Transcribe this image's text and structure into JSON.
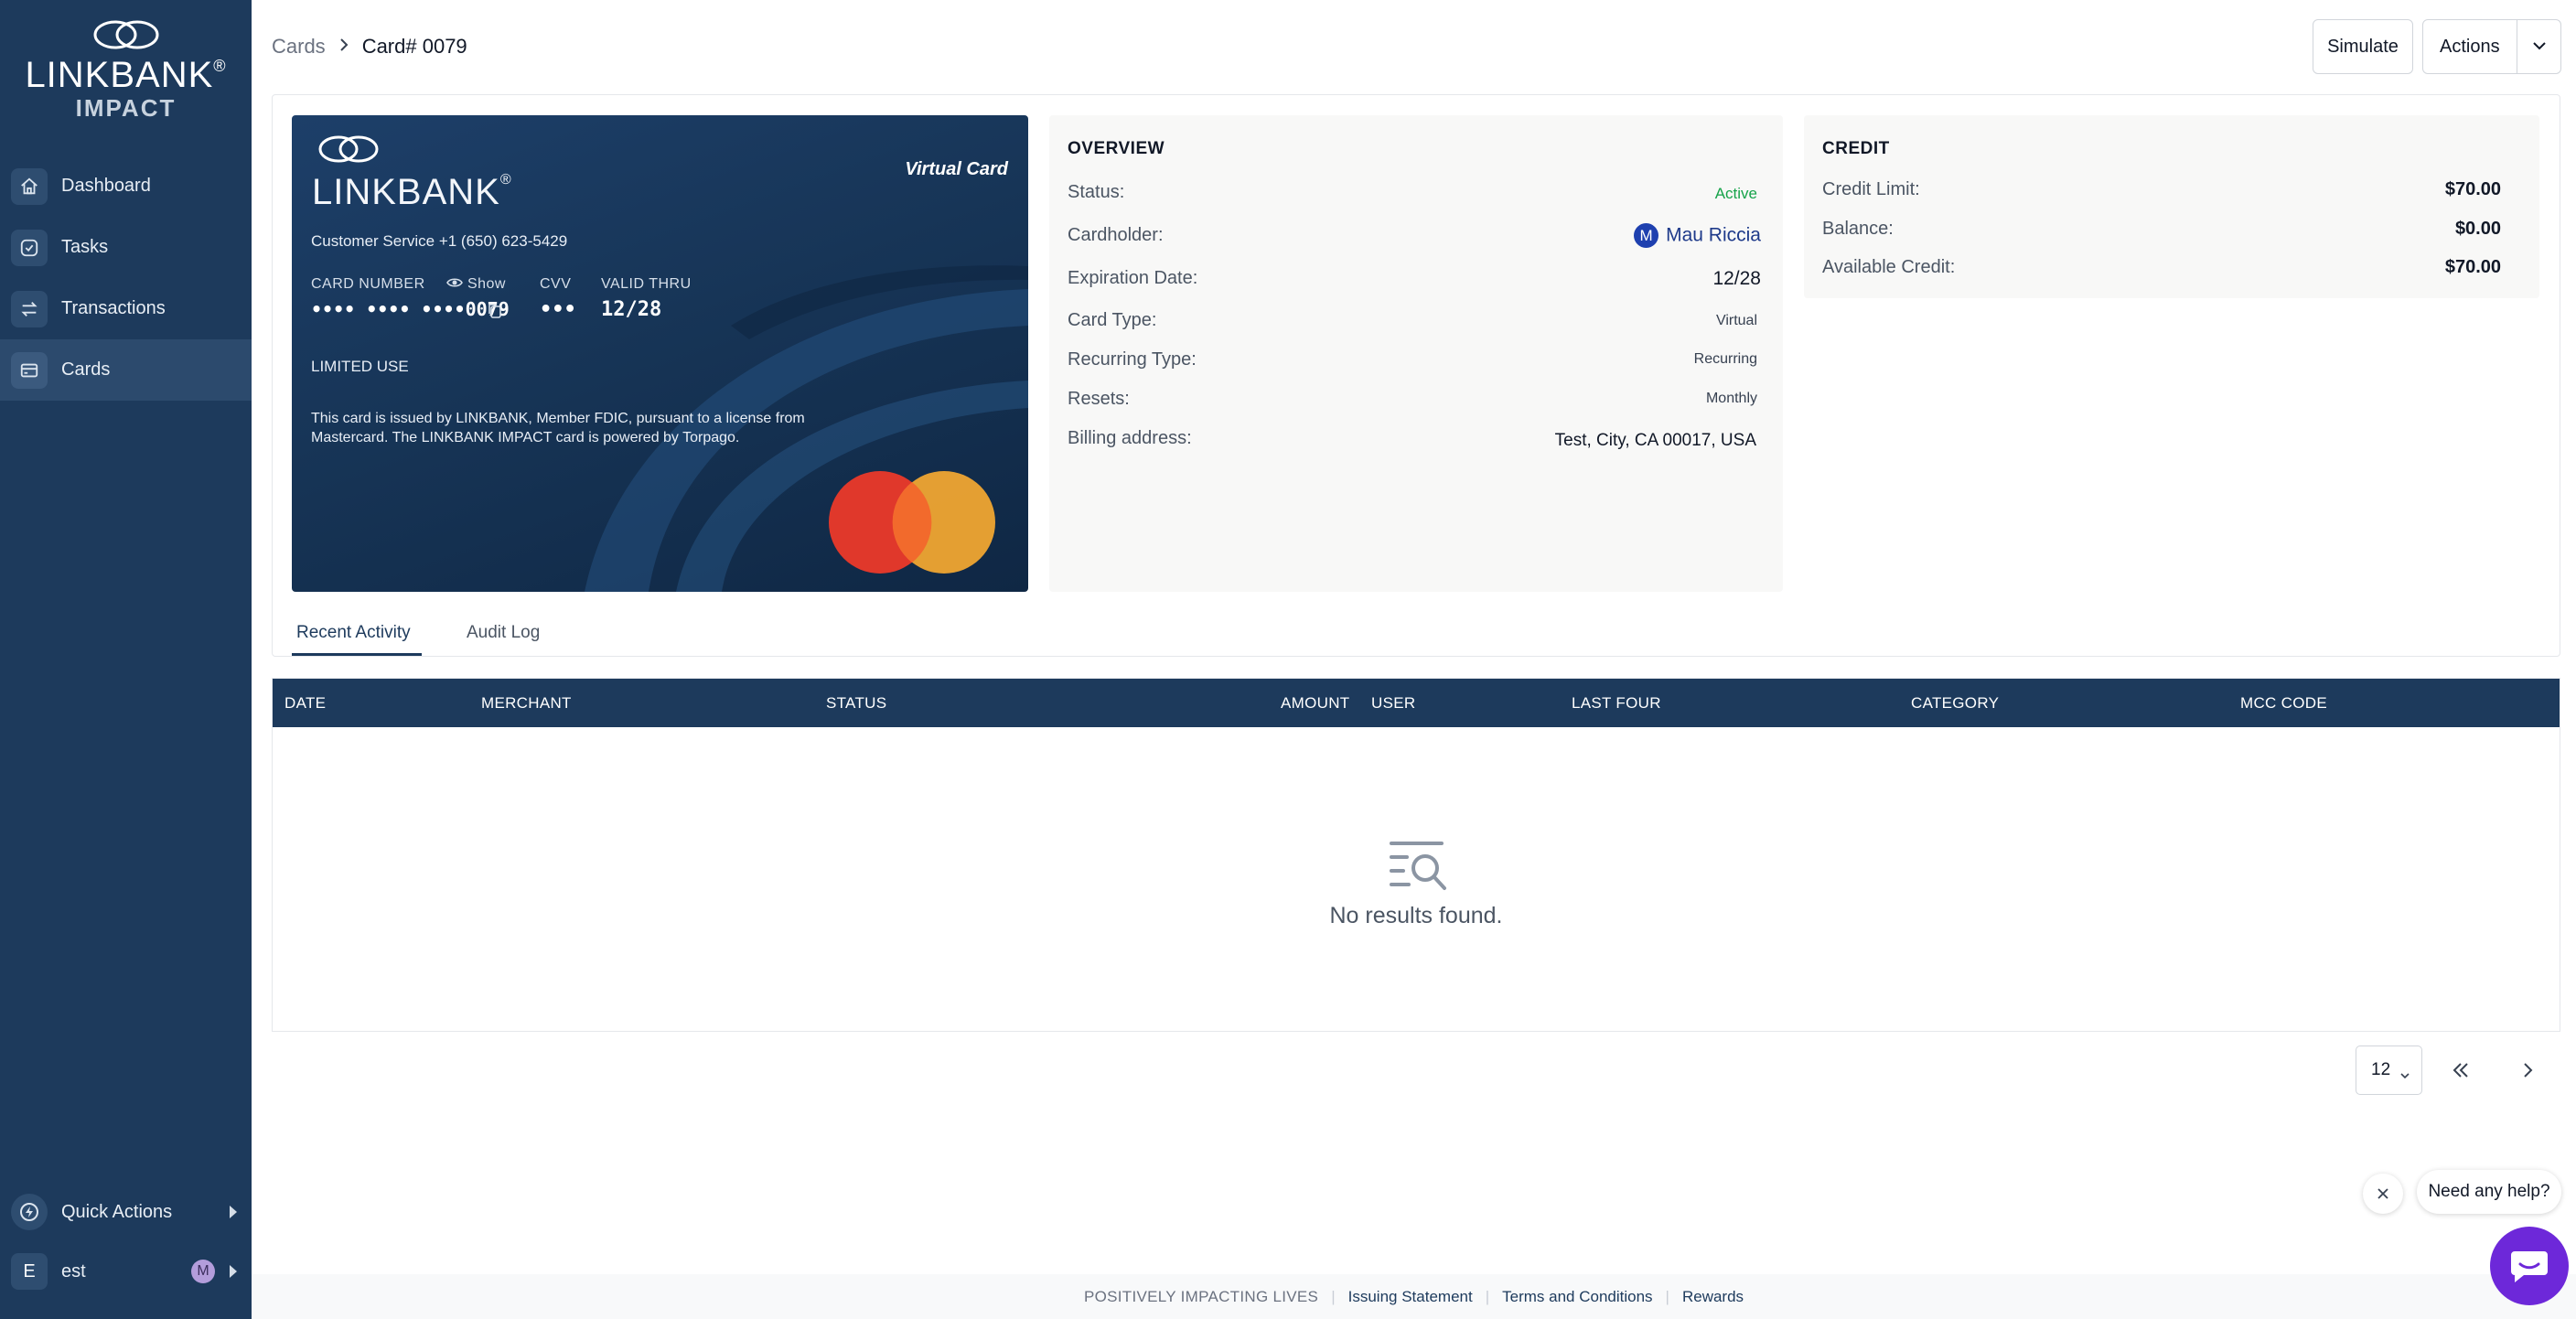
{
  "brand": {
    "name": "LINKBANK",
    "reg": "®",
    "sub": "IMPACT"
  },
  "sidebar": {
    "items": [
      {
        "label": "Dashboard",
        "icon": "home-icon"
      },
      {
        "label": "Tasks",
        "icon": "check-circle-icon"
      },
      {
        "label": "Transactions",
        "icon": "transfer-icon"
      },
      {
        "label": "Cards",
        "icon": "card-icon",
        "active": true
      }
    ],
    "quick_actions": "Quick Actions",
    "user": {
      "initial": "E",
      "name": "est",
      "avatar": "M"
    }
  },
  "breadcrumb": {
    "parent": "Cards",
    "current": "Card# 0079"
  },
  "header": {
    "simulate": "Simulate",
    "actions": "Actions"
  },
  "card": {
    "virtual": "Virtual Card",
    "service": "Customer Service +1 (650) 623-5429",
    "number_label": "CARD NUMBER",
    "show": "Show",
    "number": "•••• •••• ••••0079",
    "cvv_label": "CVV",
    "cvv": "•••",
    "valid_label": "VALID THRU",
    "valid": "12/28",
    "limited": "LIMITED USE",
    "legal_1": "This card is issued by LINKBANK, Member FDIC, pursuant to a license from",
    "legal_2": "Mastercard. The LINKBANK IMPACT card is powered by Torpago."
  },
  "overview": {
    "title": "OVERVIEW",
    "status_label": "Status:",
    "status": "Active",
    "cardholder_label": "Cardholder:",
    "cardholder_initial": "M",
    "cardholder": "Mau Riccia",
    "expiration_label": "Expiration Date:",
    "expiration": "12/28",
    "type_label": "Card Type:",
    "type": "Virtual",
    "recurring_label": "Recurring Type:",
    "recurring": "Recurring",
    "resets_label": "Resets:",
    "resets": "Monthly",
    "billing_label": "Billing address:",
    "billing": "Test, City, CA 00017, USA"
  },
  "credit": {
    "title": "CREDIT",
    "limit_label": "Credit Limit:",
    "limit": "$70.00",
    "balance_label": "Balance:",
    "balance": "$0.00",
    "available_label": "Available Credit:",
    "available": "$70.00"
  },
  "tabs": [
    {
      "label": "Recent Activity",
      "active": true
    },
    {
      "label": "Audit Log"
    }
  ],
  "table": {
    "columns": [
      "DATE",
      "MERCHANT",
      "STATUS",
      "AMOUNT",
      "USER",
      "LAST FOUR",
      "CATEGORY",
      "MCC CODE"
    ],
    "empty": "No results found."
  },
  "pagination": {
    "page_size": "12"
  },
  "footer": {
    "tagline": "POSITIVELY IMPACTING LIVES",
    "links": [
      "Issuing Statement",
      "Terms and Conditions",
      "Rewards"
    ]
  },
  "help": {
    "text": "Need any help?"
  },
  "colors": {
    "sidebar": "#1d3a5c",
    "accent": "#1d3a5c",
    "active_status": "#16a34a",
    "help_button": "#6d28d9"
  }
}
